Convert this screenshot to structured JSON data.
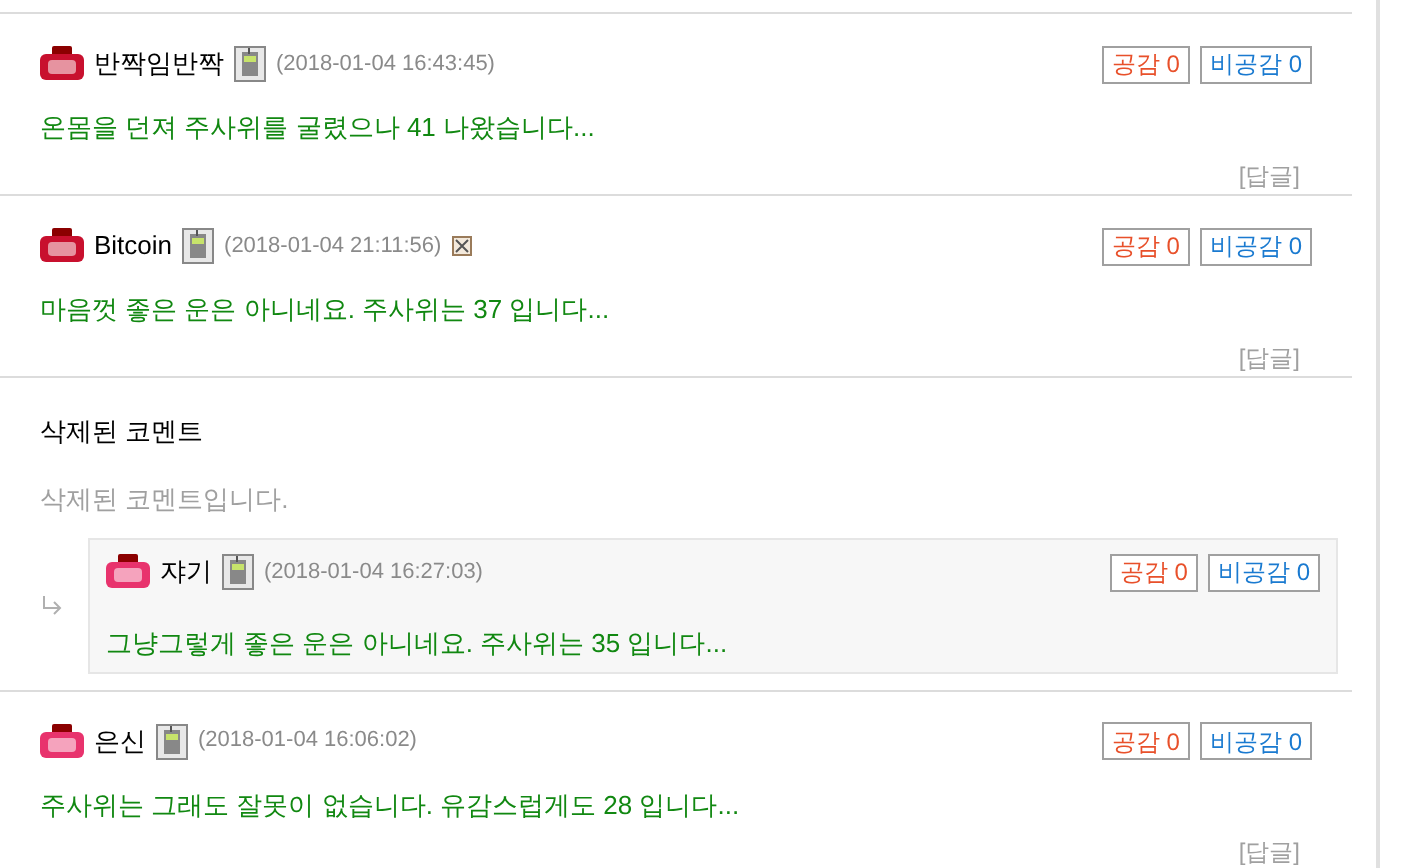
{
  "comments": [
    {
      "kind": "comment",
      "color": "#c8102e",
      "author": "반짝임반짝",
      "image_icon": false,
      "time": "(2018-01-04 16:43:45)",
      "like": "공감 0",
      "dislike": "비공감 0",
      "text": "온몸을 던져 주사위를 굴렸으나 41 나왔습니다...",
      "reply_link": "[답글]"
    },
    {
      "kind": "comment",
      "color": "#c8102e",
      "author": "Bitcoin",
      "image_icon": true,
      "time": "(2018-01-04 21:11:56)",
      "like": "공감 0",
      "dislike": "비공감 0",
      "text": "마음껏 좋은 운은 아니네요. 주사위는 37 입니다...",
      "reply_link": "[답글]"
    },
    {
      "kind": "deleted",
      "title": "삭제된 코멘트",
      "text": "삭제된 코멘트입니다.",
      "children": [
        {
          "kind": "comment",
          "color": "#e8336d",
          "author": "쟈기",
          "image_icon": false,
          "time": "(2018-01-04 16:27:03)",
          "like": "공감 0",
          "dislike": "비공감 0",
          "text": "그냥그렇게 좋은 운은 아니네요. 주사위는 35 입니다..."
        }
      ]
    },
    {
      "kind": "comment",
      "color": "#e8336d",
      "author": "은신",
      "image_icon": false,
      "time": "(2018-01-04 16:06:02)",
      "like": "공감 0",
      "dislike": "비공감 0",
      "text": "주사위는 그래도 잘못이 없습니다. 유감스럽게도 28 입니다...",
      "reply_link": "[답글]"
    }
  ]
}
